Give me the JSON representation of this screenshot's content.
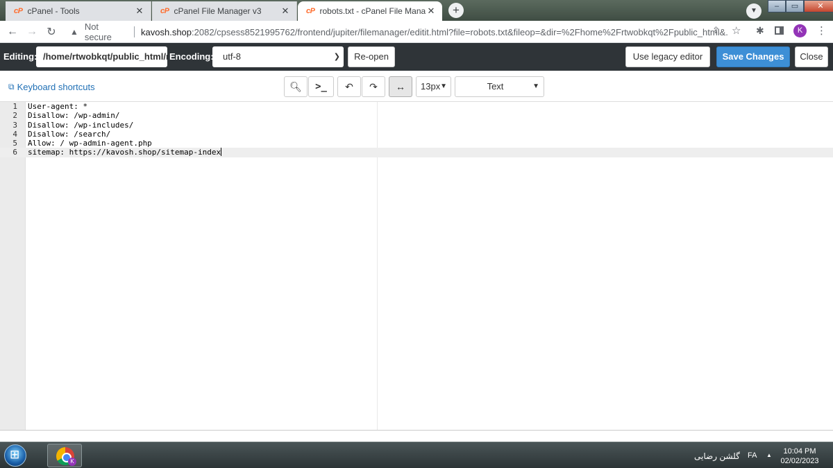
{
  "browser": {
    "tabs": [
      {
        "logo": "cP",
        "title": "cPanel - Tools",
        "active": false
      },
      {
        "logo": "cP",
        "title": "cPanel File Manager v3",
        "active": false
      },
      {
        "logo": "cP",
        "title": "robots.txt - cPanel File Manager",
        "active": true
      }
    ],
    "new_tab": "+",
    "security_label": "Not secure",
    "url_host": "kavosh.shop",
    "url_rest": ":2082/cpsess8521995762/frontend/jupiter/filemanager/editit.html?file=robots.txt&fileop=&dir=%2Fhome%2Frtwobkqt%2Fpublic_html&...",
    "profile_initial": "K"
  },
  "editor_header": {
    "editing_label": "Editing:",
    "path_value": "/home/rtwobkqt/public_html/robots.txt",
    "encoding_label": "Encoding:",
    "encoding_value": "utf-8",
    "reopen_label": "Re-open",
    "legacy_label": "Use legacy editor",
    "save_label": "Save Changes",
    "close_label": "Close"
  },
  "editor_toolbar": {
    "shortcuts_label": "Keyboard shortcuts",
    "font_size": "13px",
    "mode": "Text"
  },
  "code_lines": [
    "User-agent: *",
    "Disallow: /wp-admin/",
    "Disallow: /wp-includes/",
    "Disallow: /search/",
    "Allow: / wp-admin-agent.php",
    "sitemap: https://kavosh.shop/sitemap-index"
  ],
  "line_numbers": [
    "1",
    "2",
    "3",
    "4",
    "5",
    "6"
  ],
  "taskbar": {
    "user_name": "گلشن رضایی",
    "language": "FA",
    "time": "10:04 PM",
    "date": "02/02/2023",
    "chrome_badge": "K"
  },
  "colors": {
    "cpanel_logo": "#ff6c2c",
    "save_button": "#3d8fd6",
    "editor_header_bg": "#2f3438",
    "link": "#1f6fb5"
  }
}
